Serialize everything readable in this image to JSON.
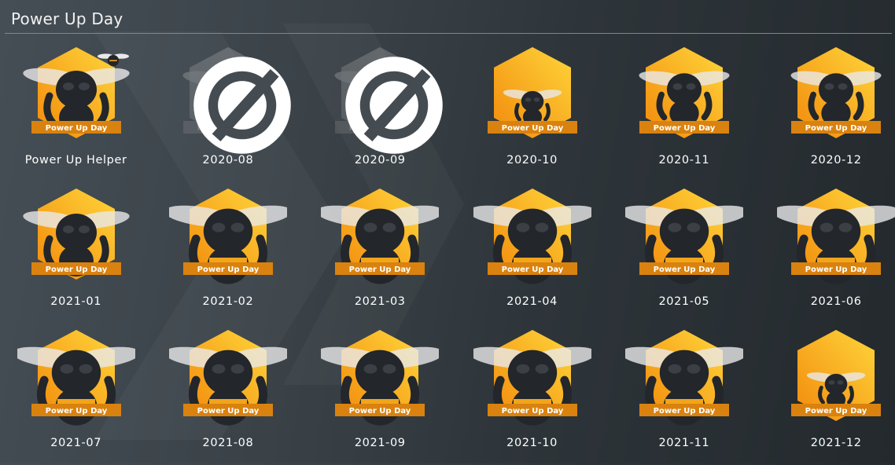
{
  "page": {
    "title": "Power Up Day"
  },
  "colors": {
    "hex_light": "#ffd53a",
    "hex_dark": "#f28a0c",
    "ribbon": "#d9820f",
    "bee_body": "#23262a"
  },
  "ribbon_text": "Power Up Day",
  "badges": [
    {
      "label": "Power Up Helper",
      "state": "earned",
      "variant": "helper"
    },
    {
      "label": "2020-08",
      "state": "locked",
      "variant": "small"
    },
    {
      "label": "2020-09",
      "state": "locked",
      "variant": "small"
    },
    {
      "label": "2020-10",
      "state": "earned",
      "variant": "tiny"
    },
    {
      "label": "2020-11",
      "state": "earned",
      "variant": "small"
    },
    {
      "label": "2020-12",
      "state": "earned",
      "variant": "small"
    },
    {
      "label": "2021-01",
      "state": "earned",
      "variant": "medium"
    },
    {
      "label": "2021-02",
      "state": "earned",
      "variant": "large"
    },
    {
      "label": "2021-03",
      "state": "earned",
      "variant": "large"
    },
    {
      "label": "2021-04",
      "state": "earned",
      "variant": "large"
    },
    {
      "label": "2021-05",
      "state": "earned",
      "variant": "large"
    },
    {
      "label": "2021-06",
      "state": "earned",
      "variant": "large"
    },
    {
      "label": "2021-07",
      "state": "earned",
      "variant": "large"
    },
    {
      "label": "2021-08",
      "state": "earned",
      "variant": "large"
    },
    {
      "label": "2021-09",
      "state": "earned",
      "variant": "large"
    },
    {
      "label": "2021-10",
      "state": "earned",
      "variant": "large"
    },
    {
      "label": "2021-11",
      "state": "earned",
      "variant": "large"
    },
    {
      "label": "2021-12",
      "state": "earned",
      "variant": "tiny"
    }
  ]
}
